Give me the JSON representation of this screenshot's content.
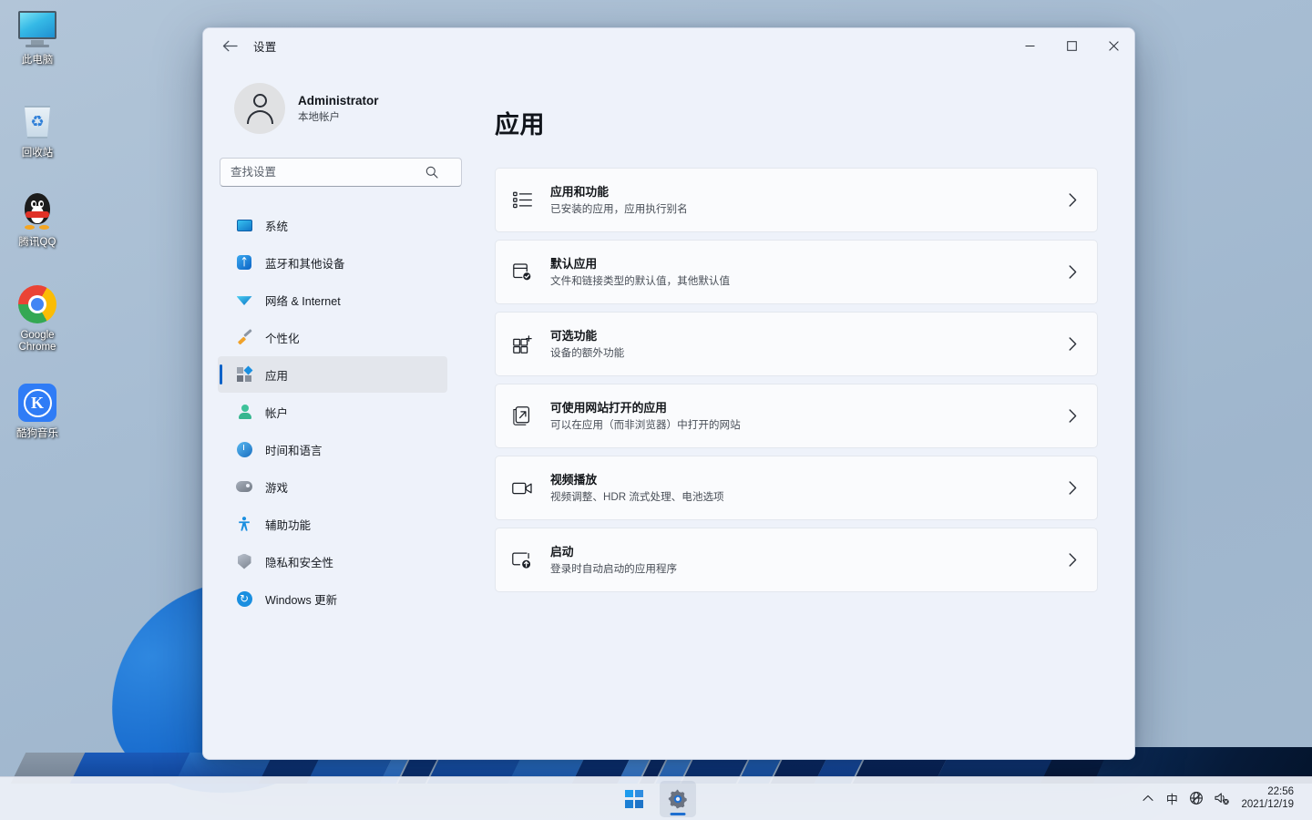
{
  "desktop": {
    "icons": [
      {
        "label": "此电脑",
        "icon": "this-pc-icon"
      },
      {
        "label": "回收站",
        "icon": "recycle-bin-icon"
      },
      {
        "label": "腾讯QQ",
        "icon": "tencent-qq-icon"
      },
      {
        "label": "Google Chrome",
        "icon": "google-chrome-icon"
      },
      {
        "label": "酷狗音乐",
        "icon": "kugou-music-icon"
      }
    ]
  },
  "taskbar": {
    "start_label": "开始",
    "settings_label": "设置",
    "tray": {
      "chevron": "˄",
      "ime": "中",
      "network": "network-disconnected-icon",
      "volume": "volume-muted-icon",
      "time": "22:56",
      "date": "2021/12/19"
    }
  },
  "window": {
    "title": "设置",
    "back_label": "←",
    "controls": {
      "minimize": "─",
      "maximize": "□",
      "close": "✕"
    }
  },
  "account": {
    "name": "Administrator",
    "subtitle": "本地帐户"
  },
  "search": {
    "placeholder": "查找设置",
    "value": ""
  },
  "sidebar": {
    "items": [
      {
        "label": "系统",
        "icon": "system-icon",
        "selected": false
      },
      {
        "label": "蓝牙和其他设备",
        "icon": "bluetooth-icon",
        "selected": false
      },
      {
        "label": "网络 & Internet",
        "icon": "network-icon",
        "selected": false
      },
      {
        "label": "个性化",
        "icon": "personalization-icon",
        "selected": false
      },
      {
        "label": "应用",
        "icon": "apps-icon",
        "selected": true
      },
      {
        "label": "帐户",
        "icon": "accounts-icon",
        "selected": false
      },
      {
        "label": "时间和语言",
        "icon": "time-language-icon",
        "selected": false
      },
      {
        "label": "游戏",
        "icon": "gaming-icon",
        "selected": false
      },
      {
        "label": "辅助功能",
        "icon": "accessibility-icon",
        "selected": false
      },
      {
        "label": "隐私和安全性",
        "icon": "privacy-security-icon",
        "selected": false
      },
      {
        "label": "Windows 更新",
        "icon": "windows-update-icon",
        "selected": false
      }
    ]
  },
  "main": {
    "title": "应用",
    "cards": [
      {
        "title": "应用和功能",
        "subtitle": "已安装的应用，应用执行别名",
        "icon": "apps-features-icon",
        "chevron": "›"
      },
      {
        "title": "默认应用",
        "subtitle": "文件和链接类型的默认值，其他默认值",
        "icon": "default-apps-icon",
        "chevron": "›"
      },
      {
        "title": "可选功能",
        "subtitle": "设备的额外功能",
        "icon": "optional-features-icon",
        "chevron": "›"
      },
      {
        "title": "可使用网站打开的应用",
        "subtitle": "可以在应用（而非浏览器）中打开的网站",
        "icon": "apps-for-websites-icon",
        "chevron": "›"
      },
      {
        "title": "视频播放",
        "subtitle": "视频调整、HDR 流式处理、电池选项",
        "icon": "video-playback-icon",
        "chevron": "›"
      },
      {
        "title": "启动",
        "subtitle": "登录时自动启动的应用程序",
        "icon": "startup-icon",
        "chevron": "›"
      }
    ]
  },
  "colors": {
    "accent": "#0f63c8",
    "window_bg": "#eef2fa",
    "card_bg": "#fafbfd",
    "desktop_bg": "#a7bdd3",
    "taskbar_bg": "#eef1f8"
  }
}
